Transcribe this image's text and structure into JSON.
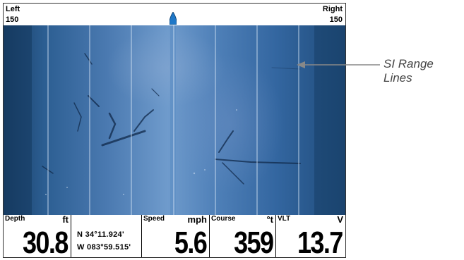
{
  "header": {
    "left_label": "Left",
    "left_value": "150",
    "right_label": "Right",
    "right_value": "150",
    "boat_icon": "boat-icon"
  },
  "sonar": {
    "view": "side-imaging",
    "colors": {
      "water_dark": "#173c63",
      "water_light": "#6f9bcc",
      "range_line": "#cfe0f2"
    }
  },
  "annotation": {
    "text": "SI Range Lines"
  },
  "data_bar": {
    "depth": {
      "label": "Depth",
      "unit": "ft",
      "value": "30.8"
    },
    "position": {
      "lat": "N 34°11.924'",
      "lon": "W 083°59.515'"
    },
    "speed": {
      "label": "Speed",
      "unit": "mph",
      "value": "5.6"
    },
    "course": {
      "label": "Course",
      "unit": "°t",
      "value": "359"
    },
    "vlt": {
      "label": "VLT",
      "unit": "V",
      "value": "13.7"
    }
  }
}
